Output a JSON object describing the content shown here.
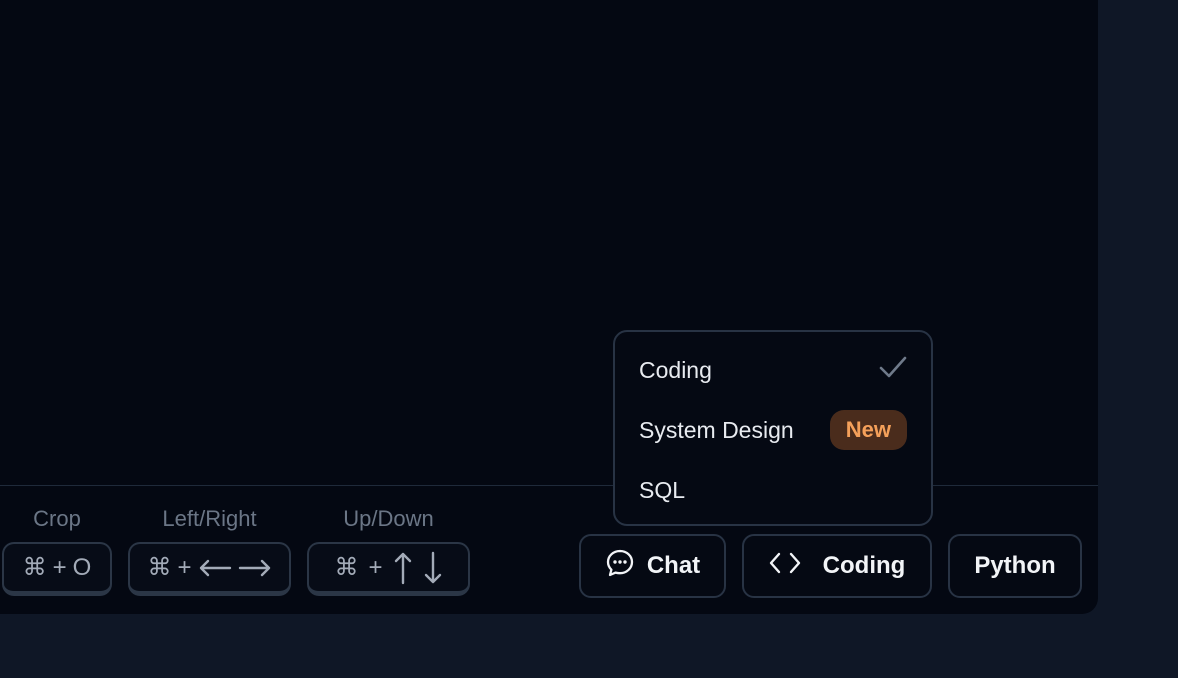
{
  "shortcuts": [
    {
      "label": "Crop",
      "mod": "⌘",
      "plus": "+",
      "key": "O"
    },
    {
      "label": "Left/Right",
      "mod": "⌘",
      "plus": "+",
      "arrows": [
        "left-arrow-icon",
        "right-arrow-icon"
      ]
    },
    {
      "label": "Up/Down",
      "mod": "⌘",
      "plus": "+",
      "arrows": [
        "up-arrow-icon",
        "down-arrow-icon"
      ]
    }
  ],
  "toolbar": {
    "chat_label": "Chat",
    "mode_label": "Coding",
    "language_label": "Python"
  },
  "mode_dropdown": {
    "items": [
      {
        "label": "Coding",
        "selected": true
      },
      {
        "label": "System Design",
        "badge": "New"
      },
      {
        "label": "SQL"
      }
    ]
  },
  "colors": {
    "background": "#0f1726",
    "panel": "#040812",
    "badge_bg": "#4a2c1c",
    "badge_text": "#f4a05a"
  }
}
